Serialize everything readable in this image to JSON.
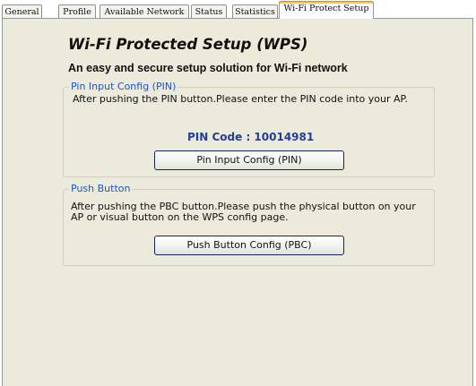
{
  "tabs": [
    {
      "label": "General",
      "active": false
    },
    {
      "label": "Profile",
      "active": false
    },
    {
      "label": "Available Network",
      "active": false
    },
    {
      "label": "Status",
      "active": false
    },
    {
      "label": "Statistics",
      "active": false
    },
    {
      "label": "Wi-Fi Protect Setup",
      "active": true
    }
  ],
  "page": {
    "title": "Wi-Fi Protected Setup (WPS)",
    "subtitle": "An easy and secure setup solution for Wi-Fi network"
  },
  "pin_group": {
    "legend": "Pin Input Config (PIN)",
    "description": "After pushing the PIN button.Please enter the PIN code into your AP.",
    "pin_code_text": "PIN Code :  10014981",
    "button_label": "Pin Input Config (PIN)"
  },
  "push_group": {
    "legend": "Push Button",
    "description": "After pushing the PBC button.Please push the physical button on your AP or visual button on the WPS config page.",
    "button_label": "Push Button Config (PBC)"
  },
  "colors": {
    "panel_background": "#ebeadb",
    "group_legend": "#1f55c4",
    "pin_code": "#243f93",
    "active_tab_highlight": "#ffc83c"
  }
}
